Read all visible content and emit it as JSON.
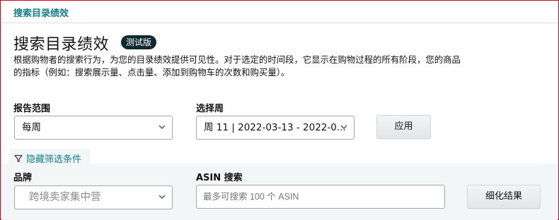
{
  "breadcrumb": "搜索目录绩效",
  "page": {
    "title": "搜索目录绩效",
    "badge": "测试版",
    "description_line1": "根据购物者的搜索行为，为您的目录绩效提供可见性。对于选定的时间段，它显示在购物过程的所有阶段，您的商品",
    "description_line2": "的指标（例如：搜索展示量、点击量、添加到购物车的次数和购买量）。"
  },
  "controls": {
    "report_range_label": "报告范围",
    "report_range_value": "每周",
    "select_week_label": "选择周",
    "select_week_value": "周 11 | 2022-03-13 - 2022-0...",
    "apply_button": "应用"
  },
  "filters": {
    "toggle_label": "隐藏筛选条件",
    "brand_label": "品牌",
    "brand_value": "跨境卖家集中营",
    "asin_label": "ASIN 搜索",
    "asin_placeholder": "最多可搜索 100 个 ASIN",
    "refine_button": "细化结果"
  },
  "colors": {
    "accent": "#147e8b",
    "badge_bg": "#0f2a2f",
    "frame_border": "#d0021b",
    "filter_band": "#f3f6f6"
  },
  "icons": {
    "select_chevron": "chevron-down-icon",
    "filter": "funnel-icon"
  }
}
